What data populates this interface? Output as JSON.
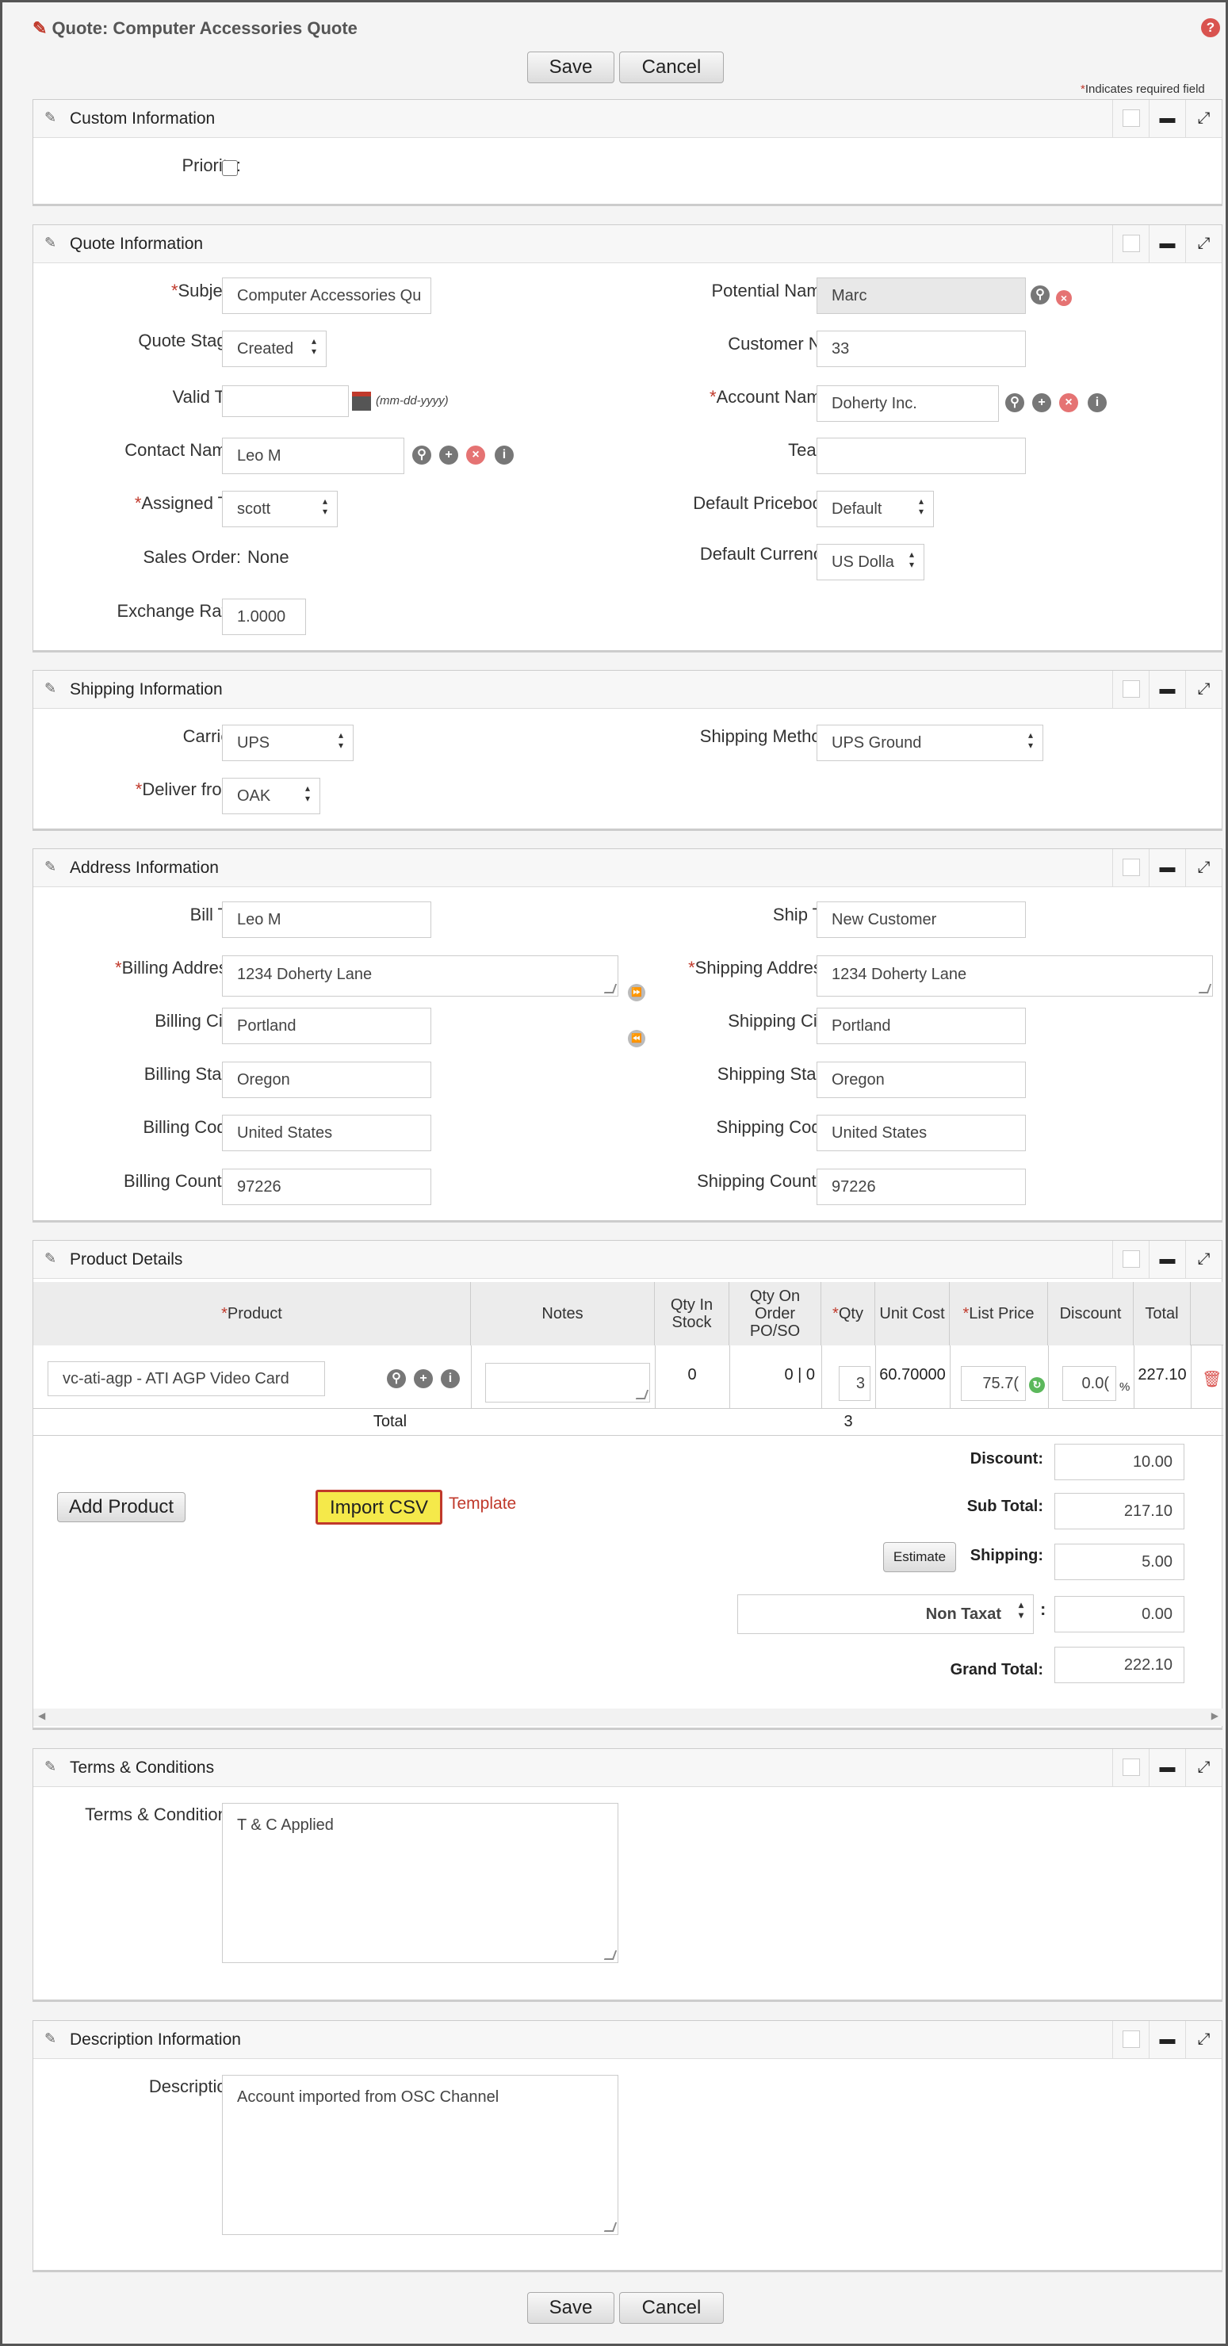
{
  "page": {
    "title": "Quote: Computer Accessories Quote",
    "save": "Save",
    "cancel": "Cancel",
    "required_mark": "*",
    "required_note": "Indicates required field"
  },
  "custom": {
    "title": "Custom Information",
    "priority_label": "Priority:"
  },
  "quote": {
    "title": "Quote Information",
    "subject_label": "Subject:",
    "subject": "Computer Accessories Qu",
    "stage_label": "Quote Stage:",
    "stage": "Created",
    "valid_label": "Valid Till:",
    "valid": "",
    "date_hint": "(mm-dd-yyyy)",
    "contact_label": "Contact Name:",
    "contact": "Leo M",
    "assigned_label": "Assigned To:",
    "assigned": "scott",
    "sales_label": "Sales Order:",
    "sales": "None",
    "rate_label": "Exchange Rate:",
    "rate": "1.0000",
    "potential_label": "Potential Name:",
    "potential": "Marc",
    "custno_label": "Customer No:",
    "custno": "33",
    "account_label": "Account Name:",
    "account": "Doherty Inc.",
    "team_label": "Team:",
    "team": "",
    "pricebook_label": "Default Pricebook:",
    "pricebook": "Default",
    "currency_label": "Default Currency:",
    "currency": "US Dolla"
  },
  "shipping": {
    "title": "Shipping Information",
    "carrier_label": "Carrier:",
    "carrier": "UPS",
    "deliver_label": "Deliver from:",
    "deliver": "OAK",
    "method_label": "Shipping Method:",
    "method": "UPS Ground"
  },
  "address": {
    "title": "Address Information",
    "billto_label": "Bill To:",
    "billto": "Leo M",
    "baddr_label": "Billing Address:",
    "baddr": "1234 Doherty Lane",
    "bcity_label": "Billing City:",
    "bcity": "Portland",
    "bstate_label": "Billing State:",
    "bstate": "Oregon",
    "bcode_label": "Billing Code:",
    "bcode": "United States",
    "bcountry_label": "Billing Country:",
    "bcountry": "97226",
    "shipto_label": "Ship To:",
    "shipto": "New Customer",
    "saddr_label": "Shipping Address:",
    "saddr": "1234 Doherty Lane",
    "scity_label": "Shipping City:",
    "scity": "Portland",
    "sstate_label": "Shipping State:",
    "sstate": "Oregon",
    "scode_label": "Shipping Code:",
    "scode": "United States",
    "scountry_label": "Shipping Country:",
    "scountry": "97226"
  },
  "product": {
    "title": "Product Details",
    "headers": {
      "product": "Product",
      "notes": "Notes",
      "stock": "Qty In Stock",
      "onorder": "Qty On Order PO/SO",
      "qty": "Qty",
      "cost": "Unit Cost",
      "list": "List Price",
      "discount": "Discount",
      "total": "Total"
    },
    "row": {
      "product": "vc-ati-agp - ATI AGP Video Card",
      "notes": "",
      "stock": "0",
      "onorder": "0 | 0",
      "qty": "3",
      "cost": "60.70000",
      "list": "75.7(",
      "discount": "0.0(",
      "pct": "%",
      "total": "227.10"
    },
    "total_label": "Total",
    "total_qty": "3",
    "add_product": "Add Product",
    "import_csv": "Import CSV",
    "template": "Template",
    "summary": {
      "discount_label": "Discount:",
      "discount": "10.00",
      "subtotal_label": "Sub Total:",
      "subtotal": "217.10",
      "estimate": "Estimate",
      "shipping_label": "Shipping:",
      "shipping": "5.00",
      "tax": "Non Taxat",
      "tax_colon": ":",
      "tax_value": "0.00",
      "grand_label": "Grand Total:",
      "grand": "222.10"
    }
  },
  "terms": {
    "title": "Terms & Conditions",
    "label": "Terms & Conditions:",
    "value": "T & C Applied"
  },
  "description": {
    "title": "Description Information",
    "label": "Description:",
    "value": "Account imported from OSC Channel"
  },
  "colors": {
    "accent_red": "#c0392b",
    "highlight": "#f5e94a"
  }
}
